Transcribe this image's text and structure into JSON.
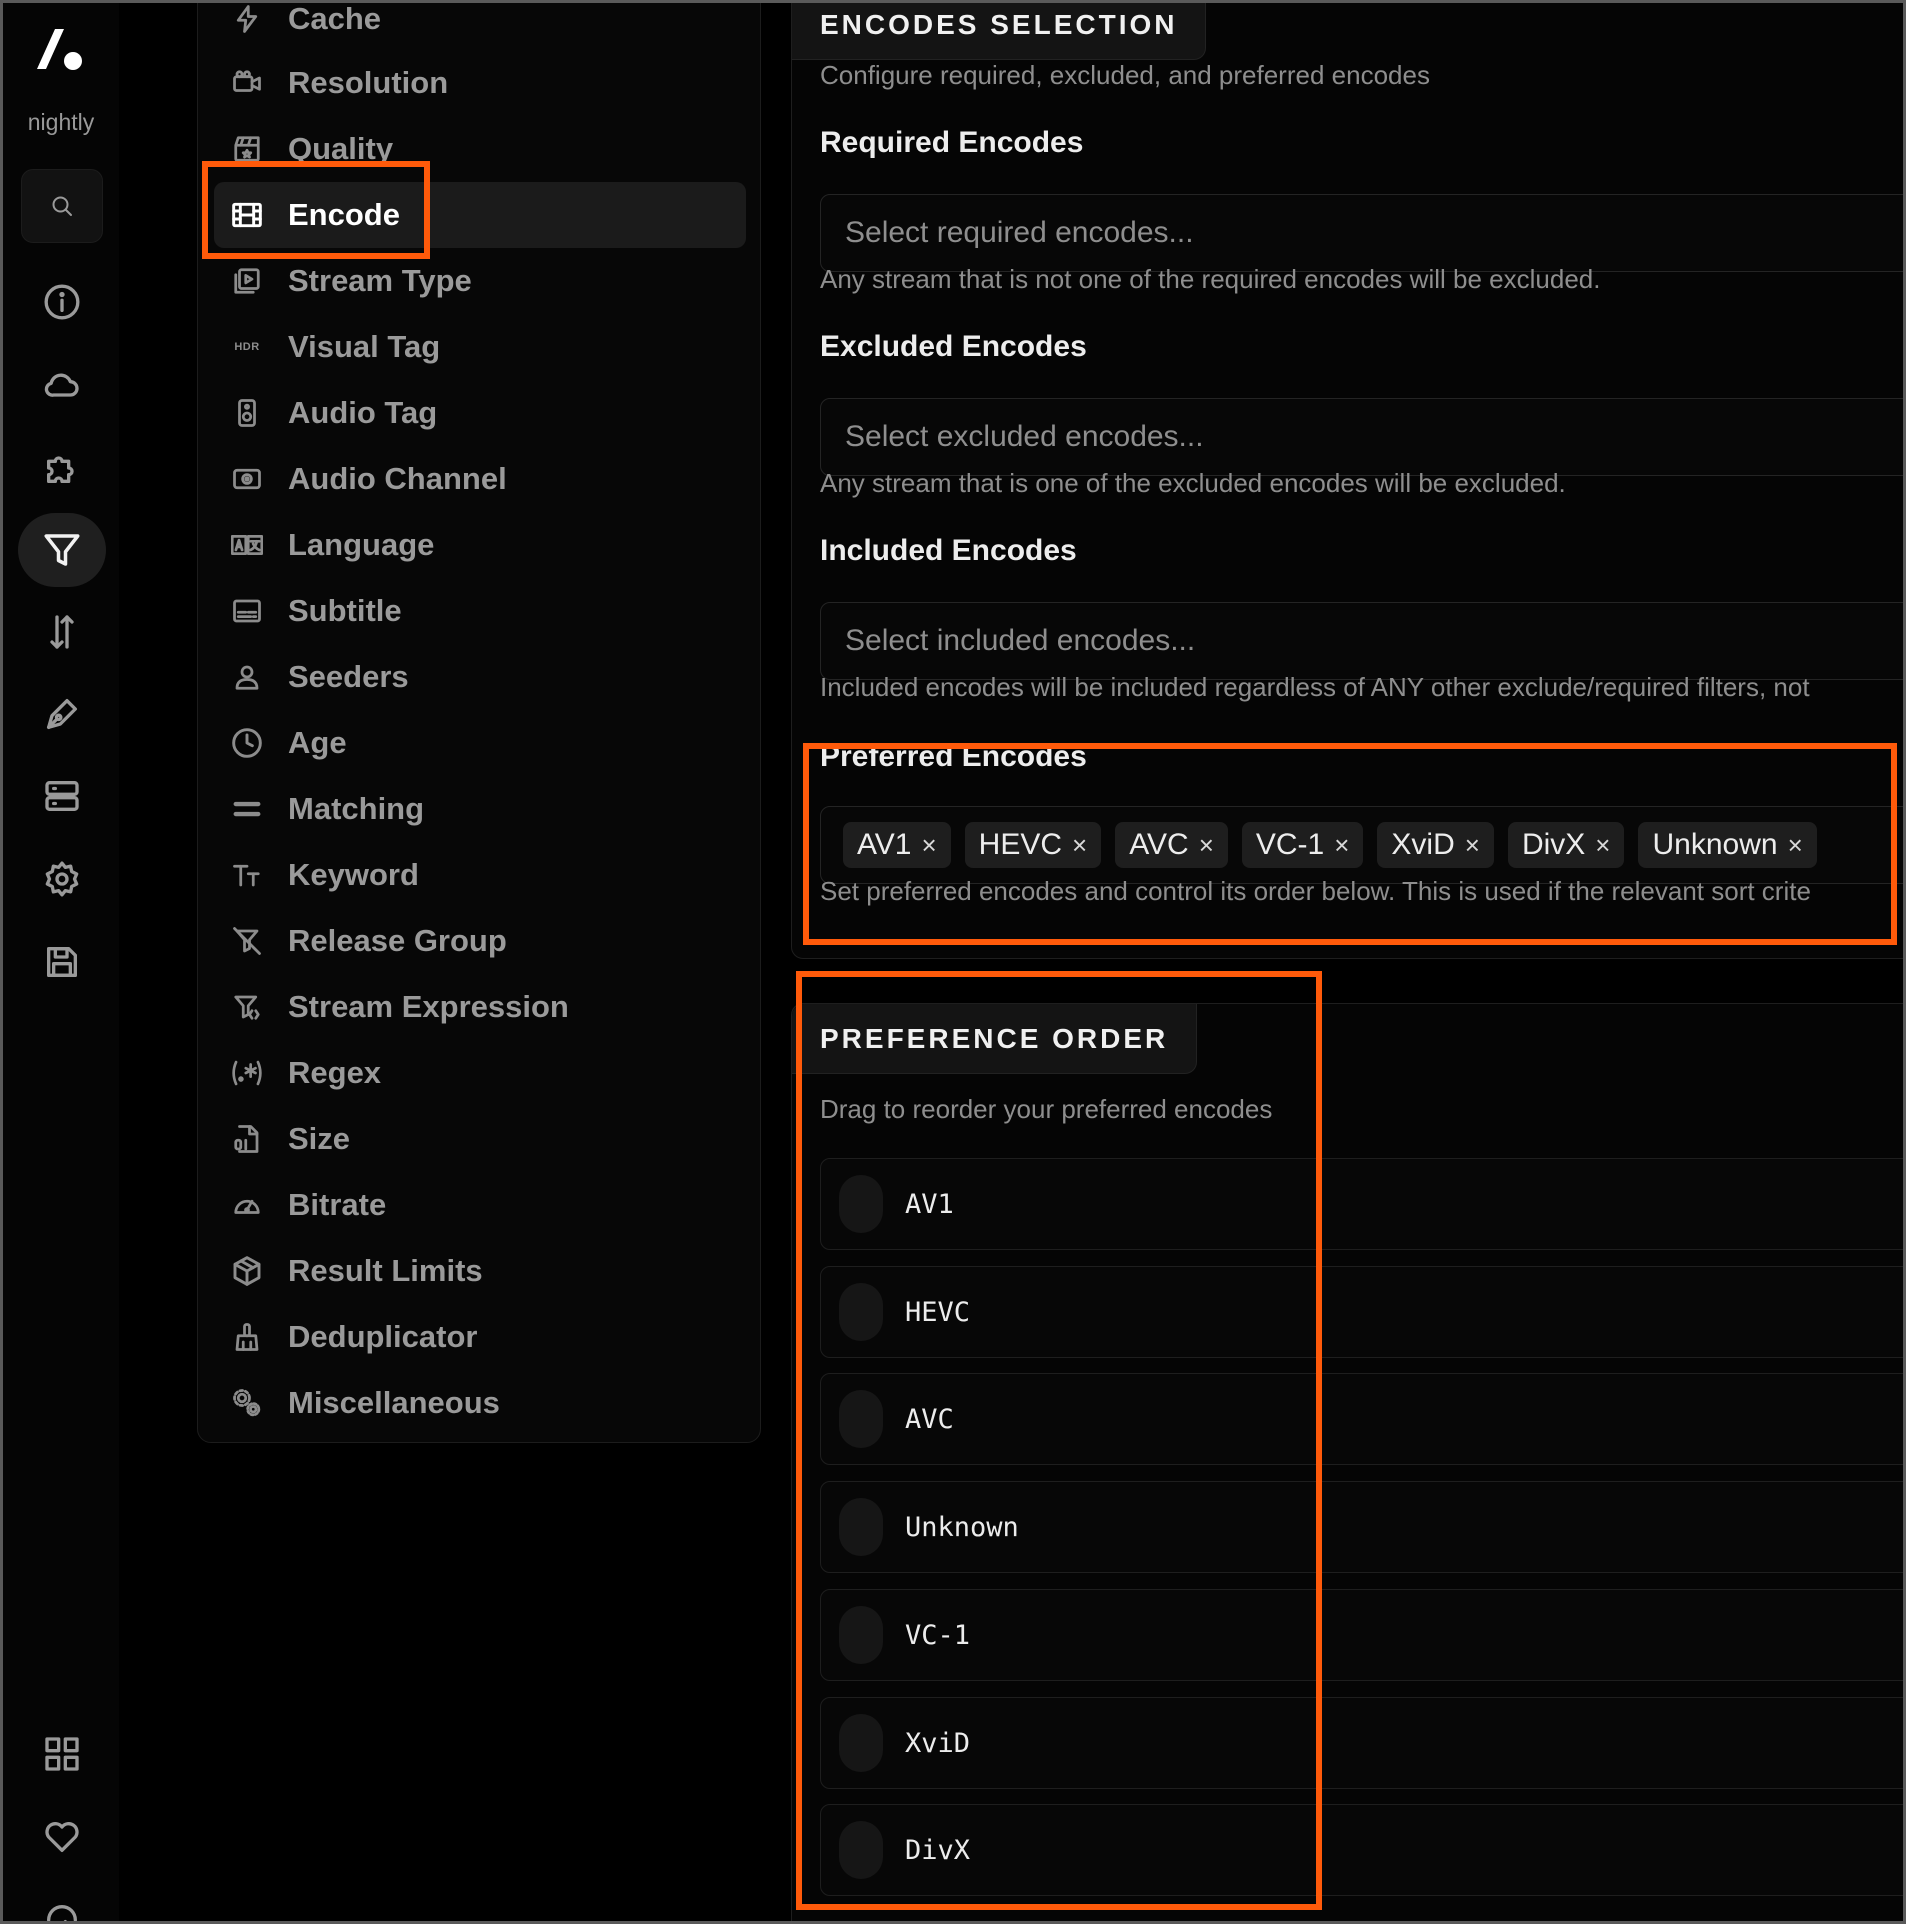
{
  "app": {
    "logo_label": "nightly"
  },
  "rail": {
    "items": [
      {
        "icon": "info-icon"
      },
      {
        "icon": "cloud-icon"
      },
      {
        "icon": "puzzle-icon"
      },
      {
        "icon": "filter-icon",
        "active": true
      },
      {
        "icon": "sort-icon"
      },
      {
        "icon": "pen-icon"
      },
      {
        "icon": "server-icon"
      },
      {
        "icon": "settings-icon"
      },
      {
        "icon": "save-icon"
      },
      {
        "icon": "grid-icon"
      },
      {
        "icon": "heart-icon"
      },
      {
        "icon": "logout-icon"
      }
    ]
  },
  "nav": {
    "items": [
      {
        "label": "Cache",
        "icon": "lightning-icon"
      },
      {
        "label": "Resolution",
        "icon": "camera-icon"
      },
      {
        "label": "Quality",
        "icon": "clapperboard-icon"
      },
      {
        "label": "Encode",
        "icon": "film-icon",
        "active": true
      },
      {
        "label": "Stream Type",
        "icon": "play-square-icon"
      },
      {
        "label": "Visual Tag",
        "icon": "hdr-icon"
      },
      {
        "label": "Audio Tag",
        "icon": "speaker-icon"
      },
      {
        "label": "Audio Channel",
        "icon": "surround-icon"
      },
      {
        "label": "Language",
        "icon": "translate-icon"
      },
      {
        "label": "Subtitle",
        "icon": "subtitle-icon"
      },
      {
        "label": "Seeders",
        "icon": "user-icon"
      },
      {
        "label": "Age",
        "icon": "clock-icon"
      },
      {
        "label": "Matching",
        "icon": "equals-icon"
      },
      {
        "label": "Keyword",
        "icon": "text-icon"
      },
      {
        "label": "Release Group",
        "icon": "group-off-icon"
      },
      {
        "label": "Stream Expression",
        "icon": "filter-code-icon"
      },
      {
        "label": "Regex",
        "icon": "regex-icon"
      },
      {
        "label": "Size",
        "icon": "file-binary-icon"
      },
      {
        "label": "Bitrate",
        "icon": "gauge-icon"
      },
      {
        "label": "Result Limits",
        "icon": "box-icon"
      },
      {
        "label": "Deduplicator",
        "icon": "broom-icon"
      },
      {
        "label": "Miscellaneous",
        "icon": "gears-icon"
      }
    ]
  },
  "encodes_card": {
    "tab_title": "ENCODES SELECTION",
    "description": "Configure required, excluded, and preferred encodes",
    "required": {
      "label": "Required Encodes",
      "placeholder": "Select required encodes...",
      "help": "Any stream that is not one of the required encodes will be excluded."
    },
    "excluded": {
      "label": "Excluded Encodes",
      "placeholder": "Select excluded encodes...",
      "help": "Any stream that is one of the excluded encodes will be excluded."
    },
    "included": {
      "label": "Included Encodes",
      "placeholder": "Select included encodes...",
      "help": "Included encodes will be included regardless of ANY other exclude/required filters, not"
    },
    "preferred": {
      "label": "Preferred Encodes",
      "chips": [
        "AV1",
        "HEVC",
        "AVC",
        "VC-1",
        "XviD",
        "DivX",
        "Unknown"
      ],
      "chip_remove": "×",
      "help": "Set preferred encodes and control its order below. This is used if the relevant sort crite"
    }
  },
  "order_card": {
    "tab_title": "PREFERENCE ORDER",
    "description": "Drag to reorder your preferred encodes",
    "items": [
      "AV1",
      "HEVC",
      "AVC",
      "Unknown",
      "VC-1",
      "XviD",
      "DivX"
    ]
  },
  "colors": {
    "highlight": "#ff5a0a",
    "background": "#000000",
    "active_text": "#ffffff"
  }
}
